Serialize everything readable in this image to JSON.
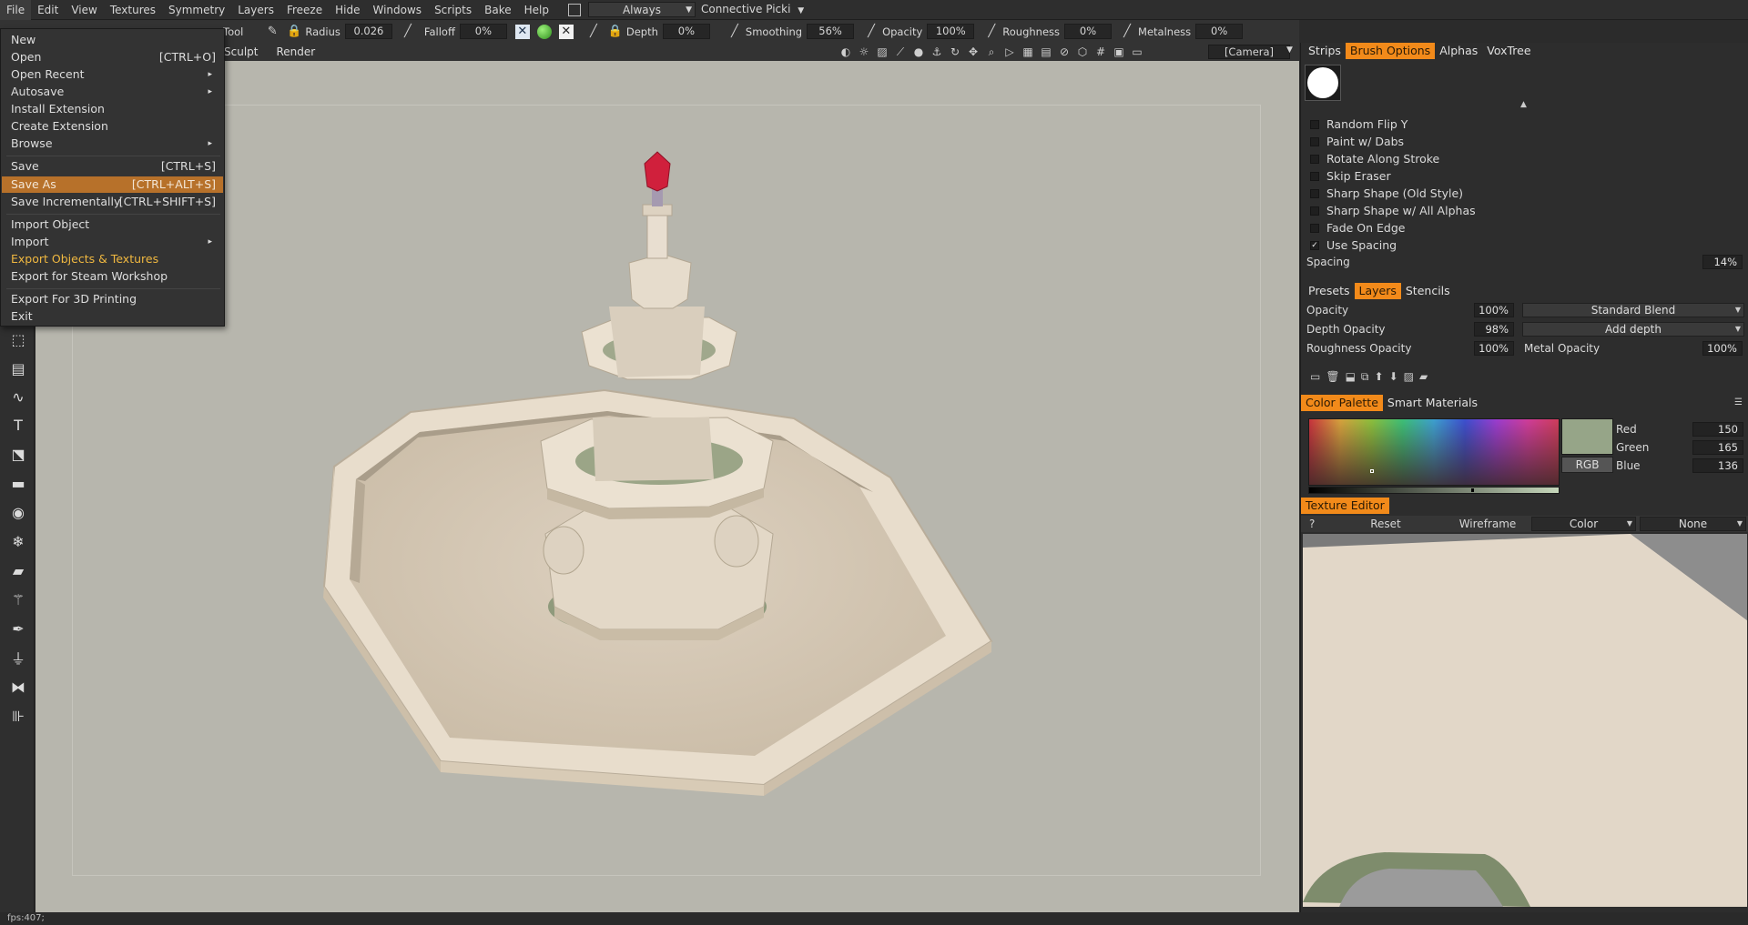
{
  "menubar": {
    "items": [
      "File",
      "Edit",
      "View",
      "Textures",
      "Symmetry",
      "Layers",
      "Freeze",
      "Hide",
      "Windows",
      "Scripts",
      "Bake",
      "Help"
    ],
    "always_combo": "Always",
    "connective_combo": "Connective Picki"
  },
  "toolbar": {
    "tool_label": "Tool",
    "radius_label": "Radius",
    "radius_value": "0.026",
    "falloff_label": "Falloff",
    "falloff_value": "0%",
    "depth_label": "Depth",
    "depth_value": "0%",
    "smoothing_label": "Smoothing",
    "smoothing_value": "56%",
    "opacity_label": "Opacity",
    "opacity_value": "100%",
    "roughness_label": "Roughness",
    "roughness_value": "0%",
    "metalness_label": "Metalness",
    "metalness_value": "0%"
  },
  "modes": {
    "sculpt": "Sculpt",
    "render": "Render",
    "camera": "[Camera]"
  },
  "file_menu": {
    "items": [
      {
        "label": "New",
        "shortcut": "",
        "submenu": false
      },
      {
        "label": "Open",
        "shortcut": "[CTRL+O]",
        "submenu": false
      },
      {
        "label": "Open Recent",
        "shortcut": "",
        "submenu": true
      },
      {
        "label": "Autosave",
        "shortcut": "",
        "submenu": true
      },
      {
        "label": "Install Extension",
        "shortcut": "",
        "submenu": false
      },
      {
        "label": "Create Extension",
        "shortcut": "",
        "submenu": false
      },
      {
        "label": "Browse",
        "shortcut": "",
        "submenu": true
      },
      {
        "label": "Save",
        "shortcut": "[CTRL+S]",
        "submenu": false
      },
      {
        "label": "Save As",
        "shortcut": "[CTRL+ALT+S]",
        "submenu": false
      },
      {
        "label": "Save Incrementally",
        "shortcut": "[CTRL+SHIFT+S]",
        "submenu": false
      },
      {
        "label": "Import Object",
        "shortcut": "",
        "submenu": false
      },
      {
        "label": "Import",
        "shortcut": "",
        "submenu": true
      },
      {
        "label": "Export Objects & Textures",
        "shortcut": "",
        "submenu": false
      },
      {
        "label": "Export for Steam Workshop",
        "shortcut": "",
        "submenu": false
      },
      {
        "label": "Export For 3D Printing",
        "shortcut": "",
        "submenu": false
      },
      {
        "label": "Exit",
        "shortcut": "",
        "submenu": false
      }
    ]
  },
  "brush_panel": {
    "tabs": [
      "Strips",
      "Brush Options",
      "Alphas",
      "VoxTree"
    ],
    "active_tab": "Brush Options",
    "options": [
      {
        "label": "Random Flip Y",
        "checked": false
      },
      {
        "label": "Paint w/ Dabs",
        "checked": false
      },
      {
        "label": "Rotate Along Stroke",
        "checked": false
      },
      {
        "label": "Skip Eraser",
        "checked": false
      },
      {
        "label": "Sharp Shape (Old Style)",
        "checked": false
      },
      {
        "label": "Sharp Shape w/ All Alphas",
        "checked": false
      },
      {
        "label": "Fade On Edge",
        "checked": false
      },
      {
        "label": "Use Spacing",
        "checked": true
      }
    ],
    "spacing_label": "Spacing",
    "spacing_value": "14%"
  },
  "layers_panel": {
    "tabs": [
      "Presets",
      "Layers",
      "Stencils"
    ],
    "active_tab": "Layers",
    "opacity_label": "Opacity",
    "opacity_value": "100%",
    "blend_mode": "Standard Blend",
    "depth_opacity_label": "Depth Opacity",
    "depth_opacity_value": "98%",
    "depth_mode": "Add depth",
    "roughness_opacity_label": "Roughness Opacity",
    "roughness_opacity_value": "100%",
    "metal_opacity_label": "Metal Opacity",
    "metal_opacity_value": "100%"
  },
  "color_panel": {
    "tabs": [
      "Color Palette",
      "Smart Materials"
    ],
    "active_tab": "Color Palette",
    "mode": "RGB",
    "red_label": "Red",
    "red": "150",
    "green_label": "Green",
    "green": "165",
    "blue_label": "Blue",
    "blue": "136",
    "swatch_color": "#96a588"
  },
  "texture_editor": {
    "title": "Texture Editor",
    "help": "?",
    "reset": "Reset",
    "wireframe": "Wireframe",
    "channel": "Color",
    "overlay": "None"
  },
  "status": {
    "fps": "fps:407;"
  },
  "colors": {
    "accent": "#f28a1a",
    "highlight": "#b7712a",
    "gold_text": "#f0b840",
    "viewport_bg": "#b7b6ad"
  }
}
